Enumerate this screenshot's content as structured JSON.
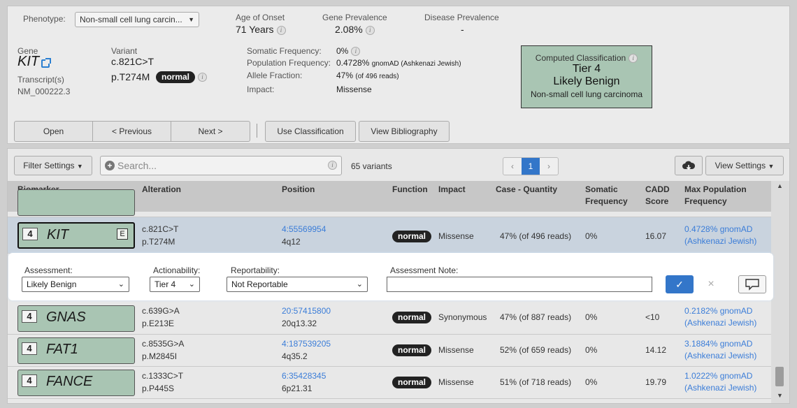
{
  "header": {
    "phenotype_label": "Phenotype:",
    "phenotype_value": "Non-small cell lung carcin...",
    "age_of_onset_label": "Age of Onset",
    "age_of_onset_value": "71 Years",
    "gene_prevalence_label": "Gene Prevalence",
    "gene_prevalence_value": "2.08%",
    "disease_prevalence_label": "Disease Prevalence",
    "disease_prevalence_value": "-"
  },
  "variant": {
    "gene_label": "Gene",
    "gene": "KIT",
    "transcript_label": "Transcript(s)",
    "transcript": "NM_000222.3",
    "variant_label": "Variant",
    "cdna": "c.821C>T",
    "protein": "p.T274M",
    "badge": "normal",
    "somatic_freq_label": "Somatic Frequency:",
    "somatic_freq_value": "0%",
    "population_freq_label": "Population Frequency:",
    "population_freq_value": "0.4728%",
    "population_freq_source": "gnomAD (Ashkenazi Jewish)",
    "allele_fraction_label": "Allele Fraction:",
    "allele_fraction_value": "47%",
    "allele_fraction_reads": "(of 496 reads)",
    "impact_label": "Impact:",
    "impact_value": "Missense"
  },
  "classification": {
    "title": "Computed Classification",
    "tier": "Tier 4",
    "label": "Likely Benign",
    "disease": "Non-small cell lung carcinoma"
  },
  "toolbar": {
    "open": "Open",
    "previous": "< Previous",
    "next": "Next >",
    "use_classification": "Use Classification",
    "view_bibliography": "View Bibliography"
  },
  "list_toolbar": {
    "filter_settings": "Filter Settings",
    "search_placeholder": "Search...",
    "variant_count": "65 variants",
    "page_prev": "‹",
    "page_current": "1",
    "page_next": "›",
    "view_settings": "View Settings"
  },
  "table": {
    "columns": {
      "biomarker": "Biomarker",
      "alteration": "Alteration",
      "position": "Position",
      "function": "Function",
      "impact": "Impact",
      "case_quantity": "Case - Quantity",
      "somatic_l1": "Somatic",
      "somatic_l2": "Frequency",
      "cadd_l1": "CADD",
      "cadd_l2": "Score",
      "maxpop_l1": "Max Population",
      "maxpop_l2": "Frequency"
    },
    "rows": [
      {
        "tier": "4",
        "gene": "KIT",
        "flag": "E",
        "cdna": "c.821C>T",
        "protein": "p.T274M",
        "position": "4:55569954",
        "band": "4q12",
        "function": "normal",
        "impact": "Missense",
        "case": "47% (of 496 reads)",
        "somatic": "0%",
        "cadd": "16.07",
        "maxpop1": "0.4728% gnomAD",
        "maxpop2": "(Ashkenazi Jewish)"
      },
      {
        "tier": "4",
        "gene": "GNAS",
        "cdna": "c.639G>A",
        "protein": "p.E213E",
        "position": "20:57415800",
        "band": "20q13.32",
        "function": "normal",
        "impact": "Synonymous",
        "case": "47% (of 887 reads)",
        "somatic": "0%",
        "cadd": "<10",
        "maxpop1": "0.2182% gnomAD",
        "maxpop2": "(Ashkenazi Jewish)"
      },
      {
        "tier": "4",
        "gene": "FAT1",
        "cdna": "c.8535G>A",
        "protein": "p.M2845I",
        "position": "4:187539205",
        "band": "4q35.2",
        "function": "normal",
        "impact": "Missense",
        "case": "52% (of 659 reads)",
        "somatic": "0%",
        "cadd": "14.12",
        "maxpop1": "3.1884% gnomAD",
        "maxpop2": "(Ashkenazi Jewish)"
      },
      {
        "tier": "4",
        "gene": "FANCE",
        "cdna": "c.1333C>T",
        "protein": "p.P445S",
        "position": "6:35428345",
        "band": "6p21.31",
        "function": "normal",
        "impact": "Missense",
        "case": "51% (of 718 reads)",
        "somatic": "0%",
        "cadd": "19.79",
        "maxpop1": "1.0222% gnomAD",
        "maxpop2": "(Ashkenazi Jewish)"
      }
    ]
  },
  "assessment": {
    "assessment_label": "Assessment:",
    "assessment_value": "Likely Benign",
    "actionability_label": "Actionability:",
    "actionability_value": "Tier 4",
    "reportability_label": "Reportability:",
    "reportability_value": "Not Reportable",
    "note_label": "Assessment Note:",
    "note_value": "",
    "confirm": "✓",
    "cancel": "×",
    "comment": "V"
  },
  "colors": {
    "tier_green": "#a9c5b3",
    "link_blue": "#3b7dd8",
    "confirm_blue": "#3376c9"
  }
}
